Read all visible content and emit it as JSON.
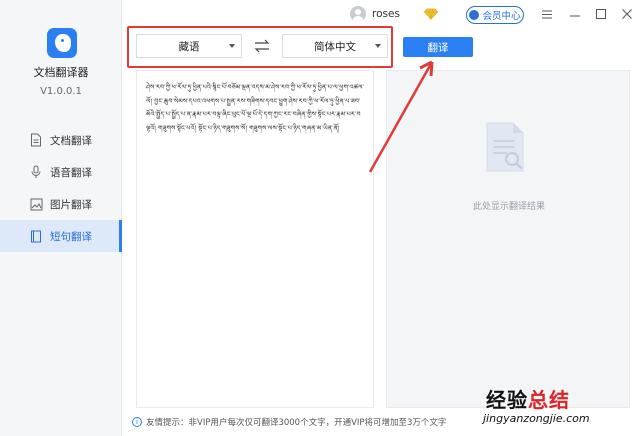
{
  "app": {
    "name": "文档翻译器",
    "version": "V1.0.0.1"
  },
  "sidebar": {
    "items": [
      {
        "label": "文档翻译",
        "icon": "document-icon",
        "active": false
      },
      {
        "label": "语音翻译",
        "icon": "microphone-icon",
        "active": false
      },
      {
        "label": "图片翻译",
        "icon": "image-icon",
        "active": false
      },
      {
        "label": "短句翻译",
        "icon": "book-icon",
        "active": true
      }
    ]
  },
  "titlebar": {
    "username": "roses",
    "vip_label": "会员中心",
    "menu_icon": "menu-icon",
    "minimize_icon": "minimize-icon",
    "maximize_icon": "maximize-icon",
    "close_icon": "close-icon"
  },
  "toolbar": {
    "source_lang": "藏语",
    "target_lang": "简体中文",
    "swap_icon": "swap-arrows-icon",
    "translate_label": "翻译"
  },
  "source_text": "ཤེས་རབ་ཀྱི་ཕ་རོལ་ཏུ་ཕྱིན་པའི་སྙིང་པོ་བཅོམ་ལྡན་འདས་མ་ཤེས་རབ་ཀྱི་ཕ་རོལ་ཏུ་ཕྱིན་པ་ལ་ཕྱག་འཚལ་ལོ། བྱང་ཆུབ་སེམས་དཔའ་འཕགས་པ་སྤྱན་རས་གཟིགས་དབང་ཕྱུག་ཤེས་རབ་ཀྱི་ཕ་རོལ་ཏུ་ཕྱིན་པ་ཟབ་མོའི་སྤྱོད་པ་སྤྱོད་པ་ན་རྣམ་པར་བལྟ་ཞིང་ཕུང་པོ་ལྔ་པོ་དེ་དག་ཀྱང་རང་བཞིན་གྱིས་སྟོང་པར་རྣམ་པར་བལྟའོ། གཟུགས་སྟོང་པའོ། སྟོང་པ་ཉིད་གཟུགས་སོ། གཟུགས་ལས་སྟོང་པ་ཉིད་གཞན་མ་ཡིན་ནོ།",
  "result": {
    "placeholder": "此处显示翻译结果"
  },
  "footer": {
    "tip": "友情提示：非VIP用户每次仅可翻译3000个文字，开通VIP将可增加至3万个文字"
  },
  "watermark": {
    "line1_a": "经验",
    "line1_b": "总结",
    "line2": "jingyanzongjie.com"
  },
  "colors": {
    "accent": "#2a7ff3",
    "annotation_red": "#e03a3a",
    "sidebar_bg": "#f5f6f8"
  }
}
